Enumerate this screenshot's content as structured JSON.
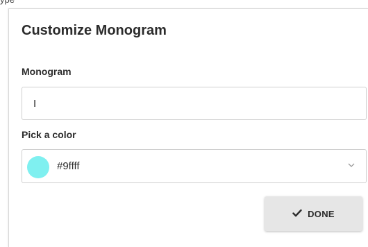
{
  "background": {
    "partial_text": "ype"
  },
  "dialog": {
    "title": "Customize Monogram",
    "monogram": {
      "label": "Monogram",
      "value": "I"
    },
    "color": {
      "label": "Pick a color",
      "value": "#9ffff",
      "swatch_color": "#7ff0f0",
      "dropdown_icon": "chevron-down-icon"
    },
    "done_button": {
      "label": "DONE",
      "icon": "check-icon"
    }
  }
}
